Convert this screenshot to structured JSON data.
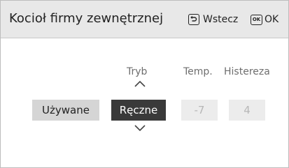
{
  "header": {
    "title": "Kocioł firmy zewnętrznej",
    "back_label": "Wstecz",
    "back_icon": "back-arrow-icon",
    "ok_icon_text": "OK",
    "ok_label": "OK"
  },
  "columns": {
    "mode_label": "Tryb",
    "temp_label": "Temp.",
    "hysteresis_label": "Histereza"
  },
  "values": {
    "used_label": "Używane",
    "mode_value": "Ręczne",
    "temp_value": "-7",
    "hysteresis_value": "4"
  },
  "colors": {
    "header_bg": "#e8e8e8",
    "selected_bg": "#3a3a3a",
    "button_bg": "#d5d5d5",
    "disabled_bg": "#ececec",
    "disabled_text": "#b7b7b7"
  }
}
